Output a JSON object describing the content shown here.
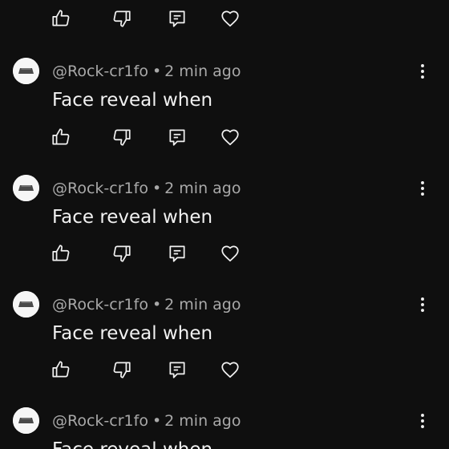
{
  "comments": [
    {
      "author": "@Rock-cr1fo",
      "time": "2 min ago",
      "text": "Face reveal when"
    },
    {
      "author": "@Rock-cr1fo",
      "time": "2 min ago",
      "text": "Face reveal when"
    },
    {
      "author": "@Rock-cr1fo",
      "time": "2 min ago",
      "text": "Face reveal when"
    },
    {
      "author": "@Rock-cr1fo",
      "time": "2 min ago",
      "text": "Face reveal when"
    }
  ],
  "separator": "•",
  "icons": {
    "like": "thumbs-up-icon",
    "dislike": "thumbs-down-icon",
    "reply": "reply-icon",
    "heart": "heart-icon",
    "more": "more-vert-icon"
  },
  "colors": {
    "background": "#0f0f0f",
    "text": "#f1f1f1",
    "meta": "#a9a9a9",
    "icon": "#f1f1f1"
  }
}
